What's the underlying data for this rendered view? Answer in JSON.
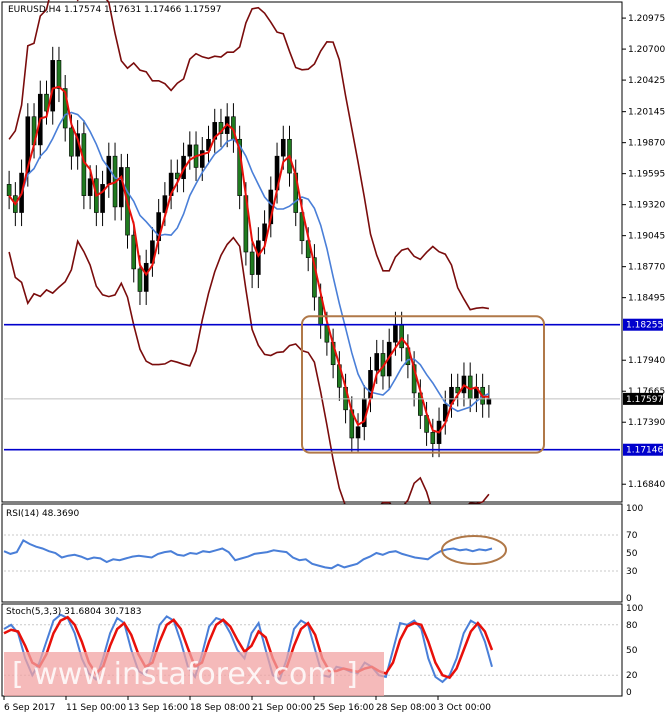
{
  "chart_data": [
    {
      "type": "candlestick",
      "panel": "price",
      "title": "EURUSD,H4  1.17574 1.17631 1.17466 1.17597",
      "symbol": "EURUSD",
      "timeframe": "H4",
      "ohlc_header": {
        "open": 1.17574,
        "high": 1.17631,
        "low": 1.17466,
        "close": 1.17597
      },
      "ylim": [
        1.167,
        1.211
      ],
      "y_ticks": [
        "1.20975",
        "1.20700",
        "1.20425",
        "1.20145",
        "1.19870",
        "1.19595",
        "1.19320",
        "1.19045",
        "1.18770",
        "1.18495",
        "1.17940",
        "1.17665",
        "1.17390",
        "1.16840"
      ],
      "x_ticks": [
        "6 Sep 2017",
        "11 Sep 00:00",
        "13 Sep 16:00",
        "18 Sep 08:00",
        "21 Sep 00:00",
        "25 Sep 16:00",
        "28 Sep 08:00",
        "3 Oct 00:00"
      ],
      "horizontal_levels": [
        {
          "value": 1.18255,
          "label": "1.18255",
          "color": "#0000cc"
        },
        {
          "value": 1.17146,
          "label": "1.17146",
          "color": "#0000cc"
        }
      ],
      "current_price": {
        "value": 1.17597,
        "label": "1.17597"
      },
      "candle_closes": [
        1.194,
        1.1925,
        1.196,
        1.201,
        1.1985,
        1.203,
        1.2015,
        1.206,
        1.2035,
        1.2,
        1.1975,
        1.1995,
        1.194,
        1.1955,
        1.1925,
        1.195,
        1.1975,
        1.193,
        1.1965,
        1.1905,
        1.1875,
        1.1855,
        1.188,
        1.19,
        1.1925,
        1.194,
        1.196,
        1.1955,
        1.1975,
        1.1985,
        1.1965,
        1.198,
        1.199,
        1.2005,
        1.1995,
        1.201,
        1.199,
        1.194,
        1.189,
        1.187,
        1.19,
        1.1915,
        1.1945,
        1.1975,
        1.199,
        1.196,
        1.1925,
        1.19,
        1.1885,
        1.185,
        1.1825,
        1.181,
        1.179,
        1.177,
        1.175,
        1.1725,
        1.1735,
        1.176,
        1.1785,
        1.18,
        1.178,
        1.181,
        1.1825,
        1.1805,
        1.179,
        1.1765,
        1.1745,
        1.173,
        1.172,
        1.174,
        1.1755,
        1.177,
        1.1765,
        1.178,
        1.176,
        1.177,
        1.1755,
        1.176
      ],
      "series": [
        {
          "name": "Moving Average (red)",
          "color": "#e8100a"
        },
        {
          "name": "Moving Average (blue)",
          "color": "#4a7fd8"
        },
        {
          "name": "Bollinger Bands",
          "color": "#7a0c0c"
        }
      ],
      "annotations": [
        {
          "type": "rectangle",
          "from_label": "25 Sep 16:00",
          "to_label": "3 Oct 00:00",
          "y_from": 1.1712,
          "y_to": 1.1833,
          "color": "#b07848"
        }
      ]
    },
    {
      "type": "line",
      "panel": "rsi",
      "title": "RSI(14) 48.3690",
      "indicator": "RSI(14)",
      "current_value": 48.369,
      "ylim": [
        0,
        100
      ],
      "y_ticks": [
        "100",
        "70",
        "50",
        "30",
        "0"
      ],
      "values": [
        52,
        49,
        51,
        64,
        60,
        57,
        55,
        52,
        50,
        45,
        47,
        48,
        46,
        43,
        45,
        44,
        40,
        43,
        42,
        44,
        46,
        47,
        46,
        45,
        49,
        51,
        52,
        48,
        47,
        50,
        49,
        52,
        51,
        53,
        55,
        51,
        42,
        44,
        46,
        49,
        50,
        51,
        53,
        52,
        51,
        45,
        42,
        43,
        38,
        36,
        34,
        33,
        37,
        34,
        36,
        38,
        43,
        46,
        50,
        48,
        51,
        52,
        49,
        47,
        45,
        44,
        43,
        48,
        52,
        54,
        55,
        53,
        54,
        52,
        54,
        53,
        55
      ],
      "color": "#4a7fd8",
      "annotations": [
        {
          "type": "ellipse",
          "color": "#b07848"
        }
      ]
    },
    {
      "type": "line",
      "panel": "stochastic",
      "title": "Stoch(5,3,3) 31.6804 30.7183",
      "indicator": "Stoch(5,3,3)",
      "main_value": 31.6804,
      "signal_value": 30.7183,
      "ylim": [
        0,
        100
      ],
      "y_ticks": [
        "100",
        "80",
        "50",
        "20",
        "0"
      ],
      "series": [
        {
          "name": "%K",
          "color": "#4a7fd8",
          "values": [
            75,
            80,
            70,
            40,
            20,
            35,
            60,
            85,
            92,
            88,
            70,
            40,
            22,
            15,
            40,
            70,
            88,
            82,
            50,
            25,
            20,
            45,
            80,
            90,
            85,
            60,
            30,
            18,
            45,
            78,
            88,
            85,
            70,
            50,
            40,
            70,
            82,
            50,
            20,
            15,
            40,
            75,
            85,
            80,
            50,
            20,
            18,
            30,
            28,
            24,
            22,
            35,
            30,
            20,
            18,
            50,
            82,
            80,
            85,
            75,
            40,
            18,
            12,
            20,
            40,
            70,
            85,
            80,
            60,
            30
          ]
        },
        {
          "name": "%D",
          "color": "#e8100a",
          "values": [
            70,
            74,
            72,
            55,
            35,
            30,
            45,
            70,
            85,
            89,
            80,
            60,
            35,
            22,
            30,
            55,
            75,
            82,
            68,
            45,
            30,
            35,
            60,
            80,
            86,
            75,
            52,
            30,
            35,
            60,
            80,
            86,
            78,
            62,
            48,
            55,
            72,
            65,
            40,
            22,
            30,
            55,
            75,
            82,
            68,
            40,
            25,
            25,
            28,
            26,
            24,
            28,
            30,
            25,
            22,
            35,
            62,
            78,
            82,
            80,
            60,
            35,
            20,
            17,
            28,
            50,
            72,
            82,
            72,
            50
          ]
        }
      ]
    }
  ],
  "watermark": "[ www.instaforex.com ]"
}
